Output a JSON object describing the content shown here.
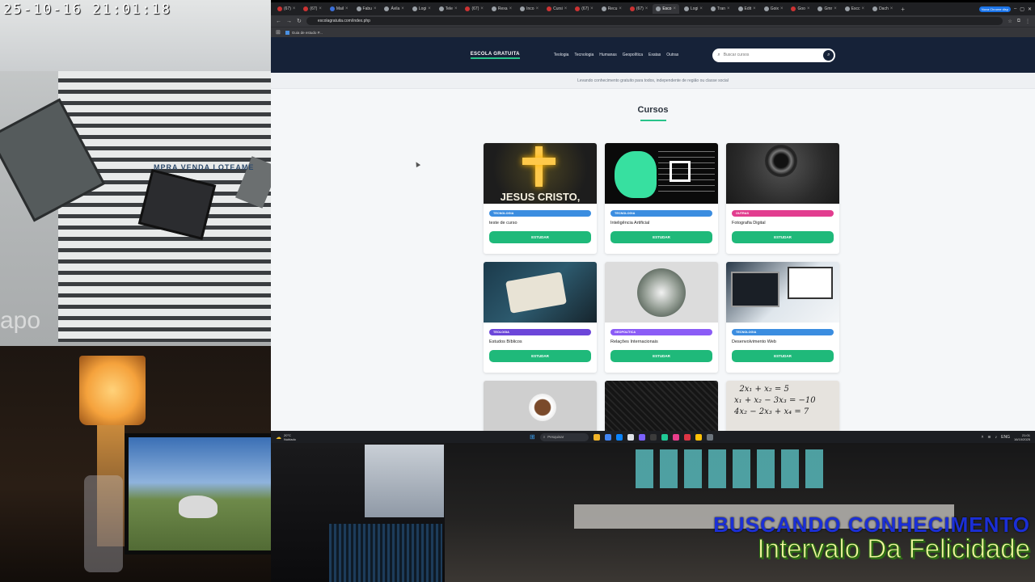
{
  "camera_top_left": {
    "timestamp": "25-10-16  21:01:18",
    "shop_sign": "MPRA   VENDA   LOTEAME",
    "watermark": "apo"
  },
  "camera_bottom_right": {
    "overlay_line1": "BUSCANDO CONHECIMENTO",
    "overlay_line2": "Intervalo Da Felicidade"
  },
  "browser": {
    "tabs": [
      {
        "label": "(67)",
        "icon": "youtube-icon"
      },
      {
        "label": "(67)",
        "icon": "youtube-icon"
      },
      {
        "label": "Mail",
        "icon": "mail-icon"
      },
      {
        "label": "Fabu",
        "icon": "page-icon"
      },
      {
        "label": "Ávila",
        "icon": "page-icon"
      },
      {
        "label": "Logi",
        "icon": "page-icon"
      },
      {
        "label": "Tele",
        "icon": "page-icon"
      },
      {
        "label": "(67)",
        "icon": "youtube-icon"
      },
      {
        "label": "Rexa",
        "icon": "page-icon"
      },
      {
        "label": "Inco",
        "icon": "page-icon"
      },
      {
        "label": "Cursi",
        "icon": "youtube-icon"
      },
      {
        "label": "(67)",
        "icon": "youtube-icon"
      },
      {
        "label": "Recu",
        "icon": "page-icon"
      },
      {
        "label": "(67)",
        "icon": "youtube-icon"
      },
      {
        "label": "Esco",
        "icon": "page-icon",
        "active": true
      },
      {
        "label": "Logi",
        "icon": "page-icon"
      },
      {
        "label": "Tran",
        "icon": "page-icon"
      },
      {
        "label": "Edit",
        "icon": "page-icon"
      },
      {
        "label": "Goix",
        "icon": "page-icon"
      },
      {
        "label": "Goo",
        "icon": "youtube-icon"
      },
      {
        "label": "Gmr",
        "icon": "page-icon"
      },
      {
        "label": "Escc",
        "icon": "page-icon"
      },
      {
        "label": "Dach",
        "icon": "page-icon"
      }
    ],
    "new_tab": "+",
    "profile_button": "Nova Chrome disp",
    "url": "escolagratuita.com/index.php",
    "bookmark": "Guia de estudo P..."
  },
  "site": {
    "logo": "ESCOLA GRATUITA",
    "nav": [
      "Teologia",
      "Tecnologia",
      "Humanas",
      "Geopolítica",
      "Exatas",
      "Outras"
    ],
    "search_placeholder": "Buscar cursos",
    "tagline": "Levando conhecimento gratuito para todos, independente de região ou classe social",
    "section_title": "Cursos",
    "study_label": "ESTUDAR",
    "courses": [
      {
        "category": "TECNOLOGIA",
        "title": "teste de curso",
        "thumb": "JESUS CRISTO,",
        "cat_color": "#3b8de0"
      },
      {
        "category": "TECNOLOGIA",
        "title": "Inteligência Artificial",
        "thumb": "",
        "cat_color": "#3b8de0"
      },
      {
        "category": "OUTRAS",
        "title": "Fotografia Digital",
        "thumb": "",
        "cat_color": "#e23d8f"
      },
      {
        "category": "TEOLOGIA",
        "title": "Estudos Bíblicos",
        "thumb": "",
        "cat_color": "#6c46d9"
      },
      {
        "category": "GEOPOLÍTICA",
        "title": "Relações Internacionais",
        "thumb": "",
        "cat_color": "#8b5cf6"
      },
      {
        "category": "TECNOLOGIA",
        "title": "Desenvolvimento Web",
        "thumb": "",
        "cat_color": "#3b8de0"
      }
    ],
    "partial_row_equations": "  2x₁ + x₂ = 5\nx₁ + x₂ − 3x₃ = −10\n4x₂ − 2x₃ + x₄ = 7"
  },
  "taskbar": {
    "weather_temp": "20°C",
    "weather_desc": "Nublado",
    "search_placeholder": "Pesquisar",
    "lang": "ENG",
    "time": "21:01",
    "date": "16/10/2025"
  }
}
